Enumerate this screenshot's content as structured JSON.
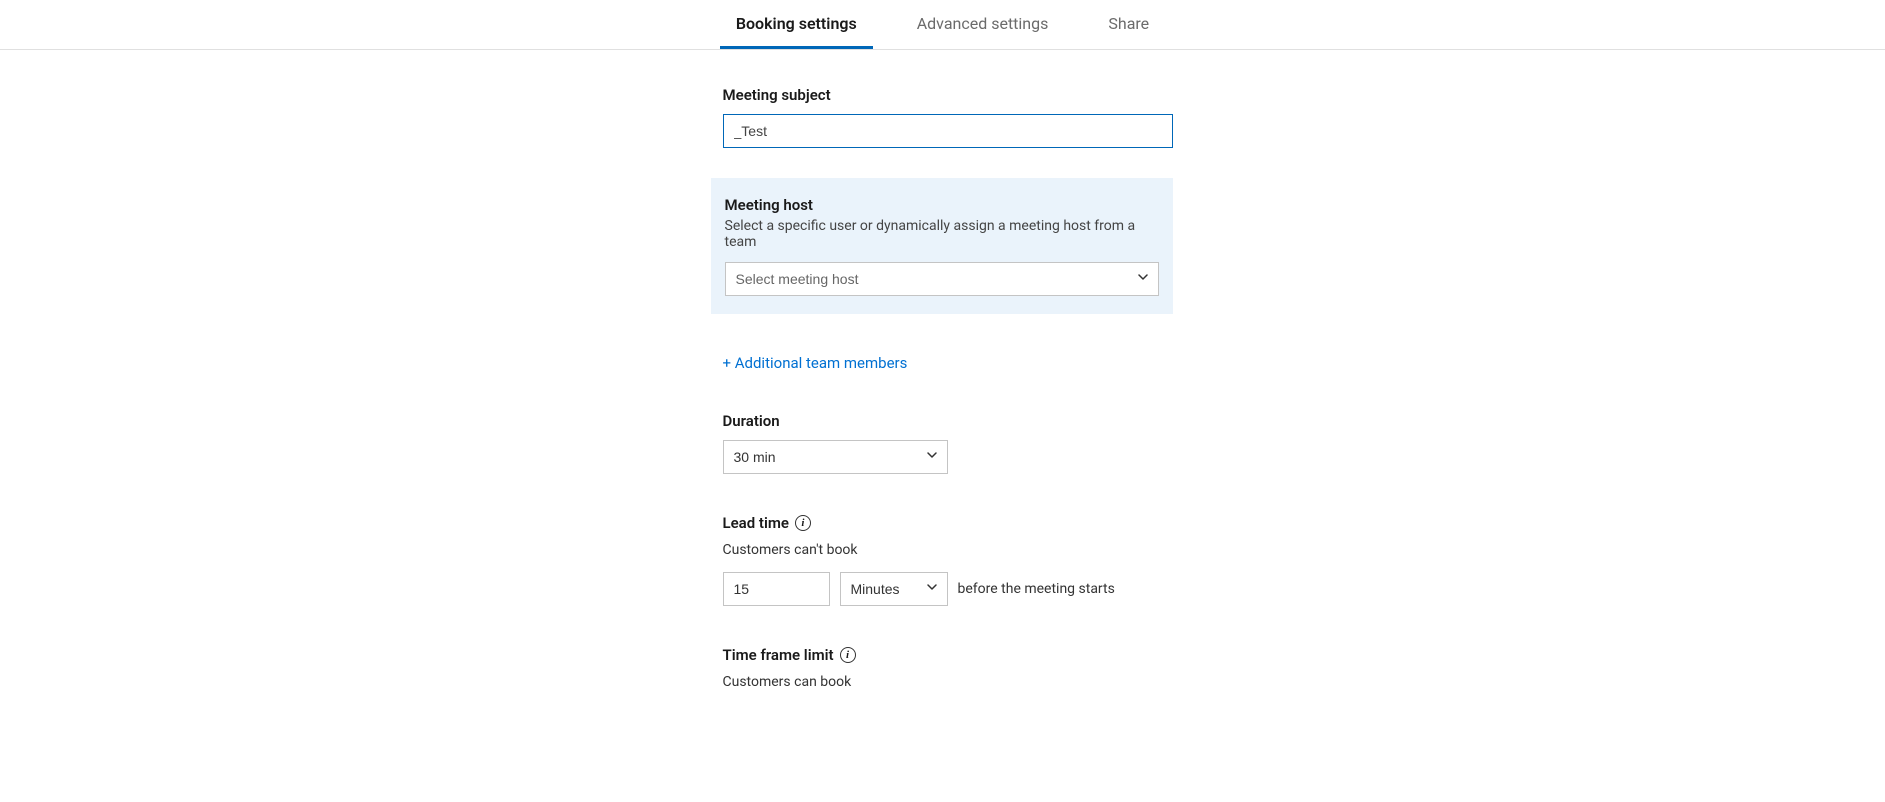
{
  "tabs": {
    "booking": "Booking settings",
    "advanced": "Advanced settings",
    "share": "Share"
  },
  "subject": {
    "label": "Meeting subject",
    "value": "_Test"
  },
  "host": {
    "label": "Meeting host",
    "desc": "Select a specific user or dynamically assign a meeting host from a team",
    "placeholder": "Select meeting host"
  },
  "addMembers": "+ Additional team members",
  "duration": {
    "label": "Duration",
    "value": "30 min"
  },
  "leadTime": {
    "label": "Lead time",
    "preText": "Customers can't book",
    "value": "15",
    "unit": "Minutes",
    "postText": "before the meeting starts"
  },
  "timeFrame": {
    "label": "Time frame limit",
    "preText": "Customers can book"
  }
}
